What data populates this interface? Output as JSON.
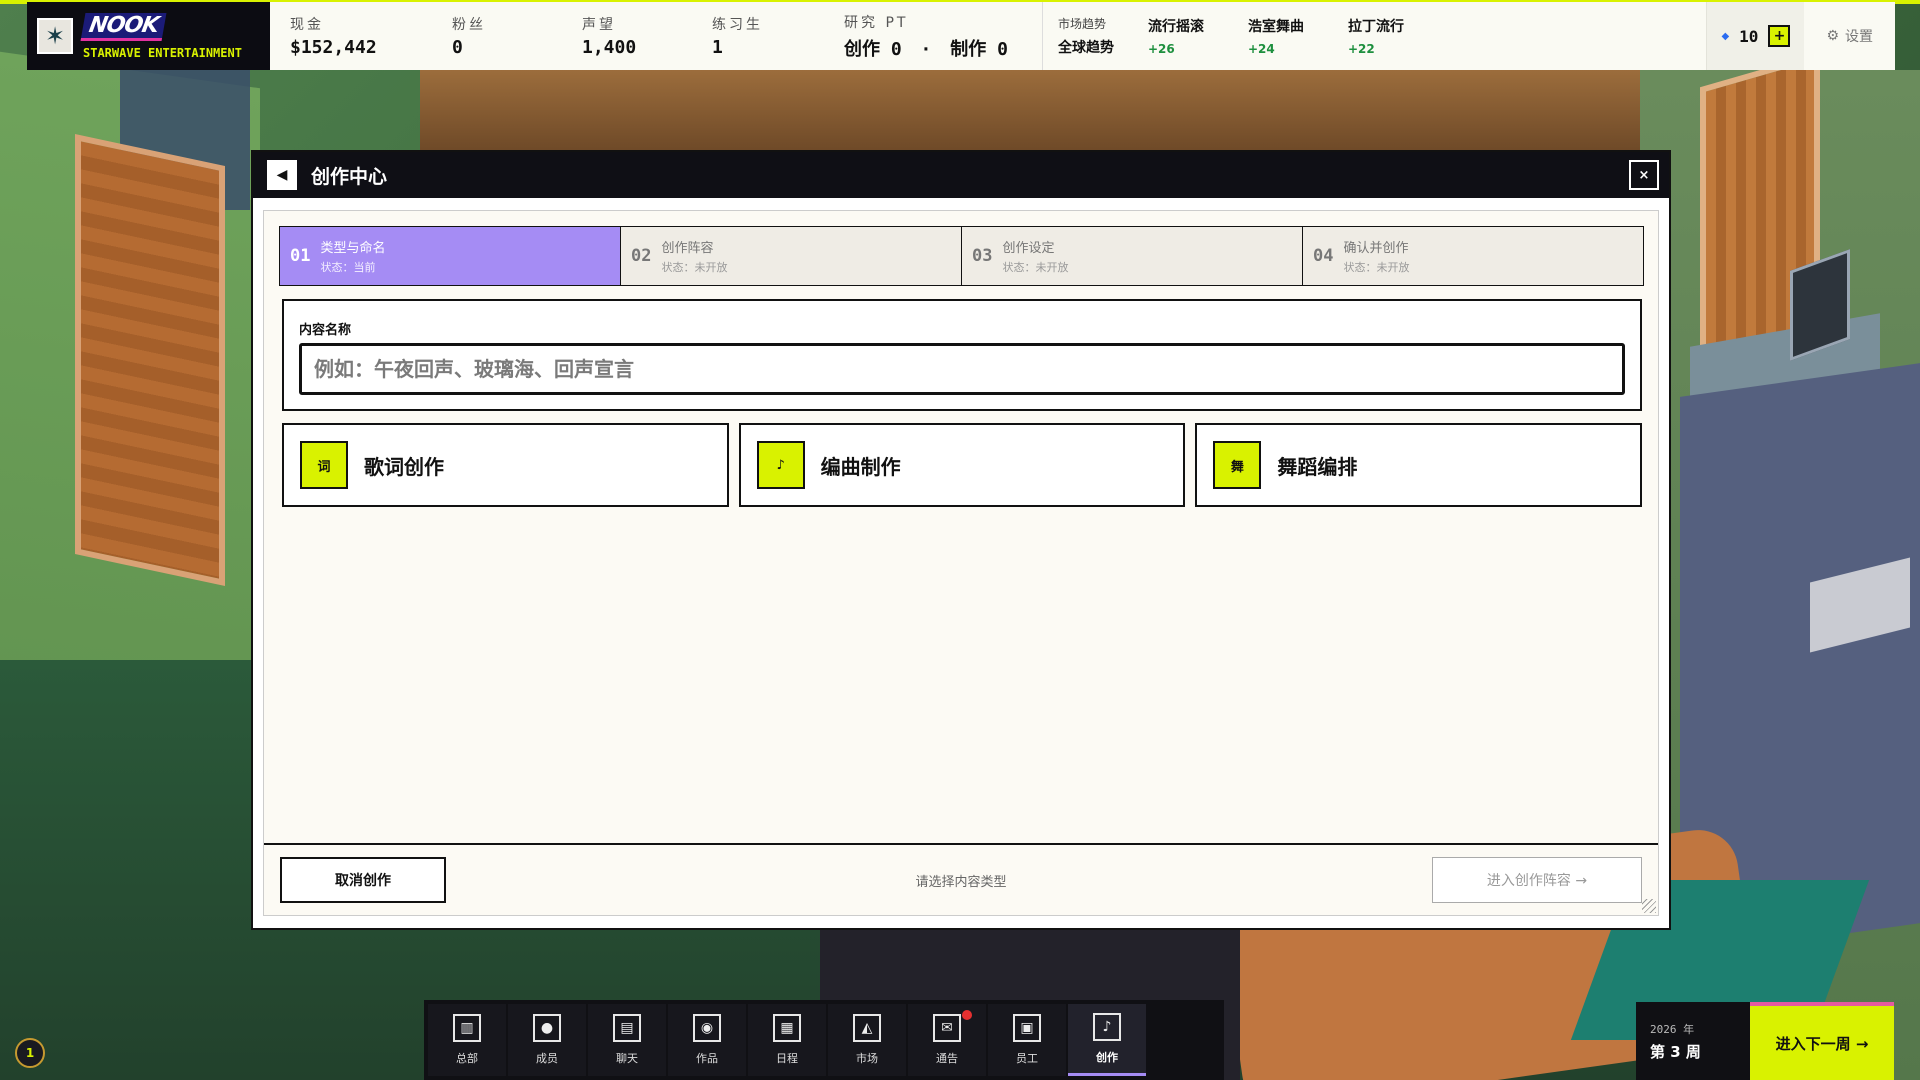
{
  "brand": {
    "logo_text": "NOOK",
    "company": "STARWAVE ENTERTAINMENT"
  },
  "stats": {
    "cash_label": "现金",
    "cash_value": "$152,442",
    "fans_label": "粉丝",
    "fans_value": "0",
    "fame_label": "声望",
    "fame_value": "1,400",
    "trainees_label": "练习生",
    "trainees_value": "1",
    "research_label": "研究 PT",
    "research_create_label": "创作",
    "research_create_value": "0",
    "research_separator": "·",
    "research_produce_label": "制作",
    "research_produce_value": "0"
  },
  "trends": {
    "heading": "市场趋势",
    "scope": "全球趋势",
    "items": [
      {
        "name": "流行摇滚",
        "change": "+26"
      },
      {
        "name": "浩室舞曲",
        "change": "+24"
      },
      {
        "name": "拉丁流行",
        "change": "+22"
      }
    ]
  },
  "currency": {
    "count": "10",
    "add_label": "+"
  },
  "settings_label": "设置",
  "modal": {
    "title": "创作中心",
    "close_label": "×",
    "back_label": "◀",
    "steps": [
      {
        "num": "01",
        "title": "类型与命名",
        "state": "状态：当前",
        "active": true
      },
      {
        "num": "02",
        "title": "创作阵容",
        "state": "状态：未开放",
        "active": false
      },
      {
        "num": "03",
        "title": "创作设定",
        "state": "状态：未开放",
        "active": false
      },
      {
        "num": "04",
        "title": "确认并创作",
        "state": "状态：未开放",
        "active": false
      }
    ],
    "name_label": "内容名称",
    "name_value": "",
    "name_placeholder": "例如：午夜回声、玻璃海、回声宣言",
    "types": [
      {
        "icon": "词",
        "label": "歌词创作"
      },
      {
        "icon": "♪",
        "label": "编曲制作"
      },
      {
        "icon": "舞",
        "label": "舞蹈编排"
      }
    ],
    "cancel_label": "取消创作",
    "hint": "请选择内容类型",
    "next_label": "进入创作阵容 →"
  },
  "nav": {
    "items": [
      {
        "label": "总部",
        "icon": "building-icon",
        "glyph": "▥"
      },
      {
        "label": "成员",
        "icon": "person-icon",
        "glyph": "●"
      },
      {
        "label": "聊天",
        "icon": "chat-icon",
        "glyph": "▤"
      },
      {
        "label": "作品",
        "icon": "disc-icon",
        "glyph": "◉"
      },
      {
        "label": "日程",
        "icon": "calendar-icon",
        "glyph": "▦"
      },
      {
        "label": "市场",
        "icon": "market-chart-icon",
        "glyph": "◭"
      },
      {
        "label": "通告",
        "icon": "announcement-icon",
        "glyph": "✉"
      },
      {
        "label": "员工",
        "icon": "briefcase-icon",
        "glyph": "▣"
      },
      {
        "label": "创作",
        "icon": "create-icon",
        "glyph": "♪"
      }
    ]
  },
  "date": {
    "year": "2026 年",
    "week": "第 3 周"
  },
  "next_week_label": "进入下一周 →",
  "level": "1",
  "colors": {
    "accent_lime": "#d9f200",
    "active_step": "#a58cf4",
    "trend_up": "#1d8f3e",
    "notify": "#e53030"
  }
}
